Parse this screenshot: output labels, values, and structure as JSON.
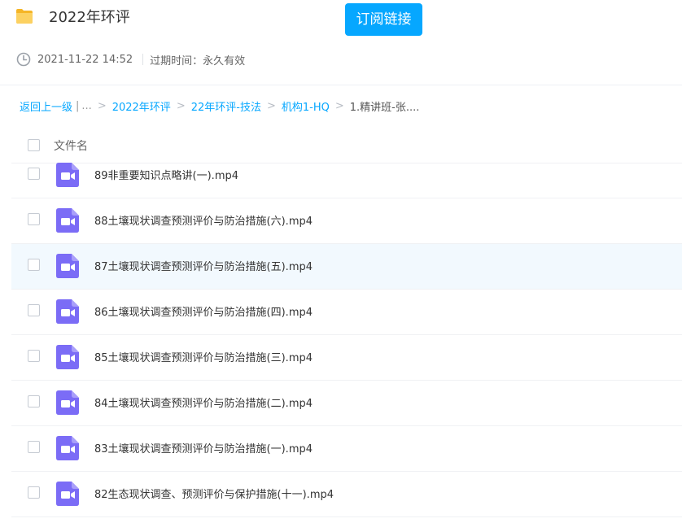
{
  "header": {
    "folder_icon": "folder-icon",
    "title": "2022年环评",
    "subscribe_label": "订阅链接",
    "accent_color": "#06a7ff"
  },
  "meta": {
    "clock_icon": "clock-icon",
    "date": "2021-11-22 14:52",
    "expire": "过期时间：永久有效"
  },
  "breadcrumb": {
    "back": "返回上一级",
    "separator": "|",
    "ellipsis": "...",
    "arrow": ">",
    "items": [
      "2022年环评",
      "22年环评-技法",
      "机构1-HQ"
    ],
    "current": "1.精讲班-张...."
  },
  "list": {
    "column_header": "文件名",
    "file_icon": "video-file-icon",
    "items": [
      {
        "name": "89非重要知识点略讲(一).mp4",
        "selected": false
      },
      {
        "name": "88土壤现状调查预测评价与防治措施(六).mp4",
        "selected": false
      },
      {
        "name": "87土壤现状调查预测评价与防治措施(五).mp4",
        "selected": true
      },
      {
        "name": "86土壤现状调查预测评价与防治措施(四).mp4",
        "selected": false
      },
      {
        "name": "85土壤现状调查预测评价与防治措施(三).mp4",
        "selected": false
      },
      {
        "name": "84土壤现状调查预测评价与防治措施(二).mp4",
        "selected": false
      },
      {
        "name": "83土壤现状调查预测评价与防治措施(一).mp4",
        "selected": false
      },
      {
        "name": "82生态现状调查、预测评价与保护措施(十一).mp4",
        "selected": false
      }
    ]
  }
}
